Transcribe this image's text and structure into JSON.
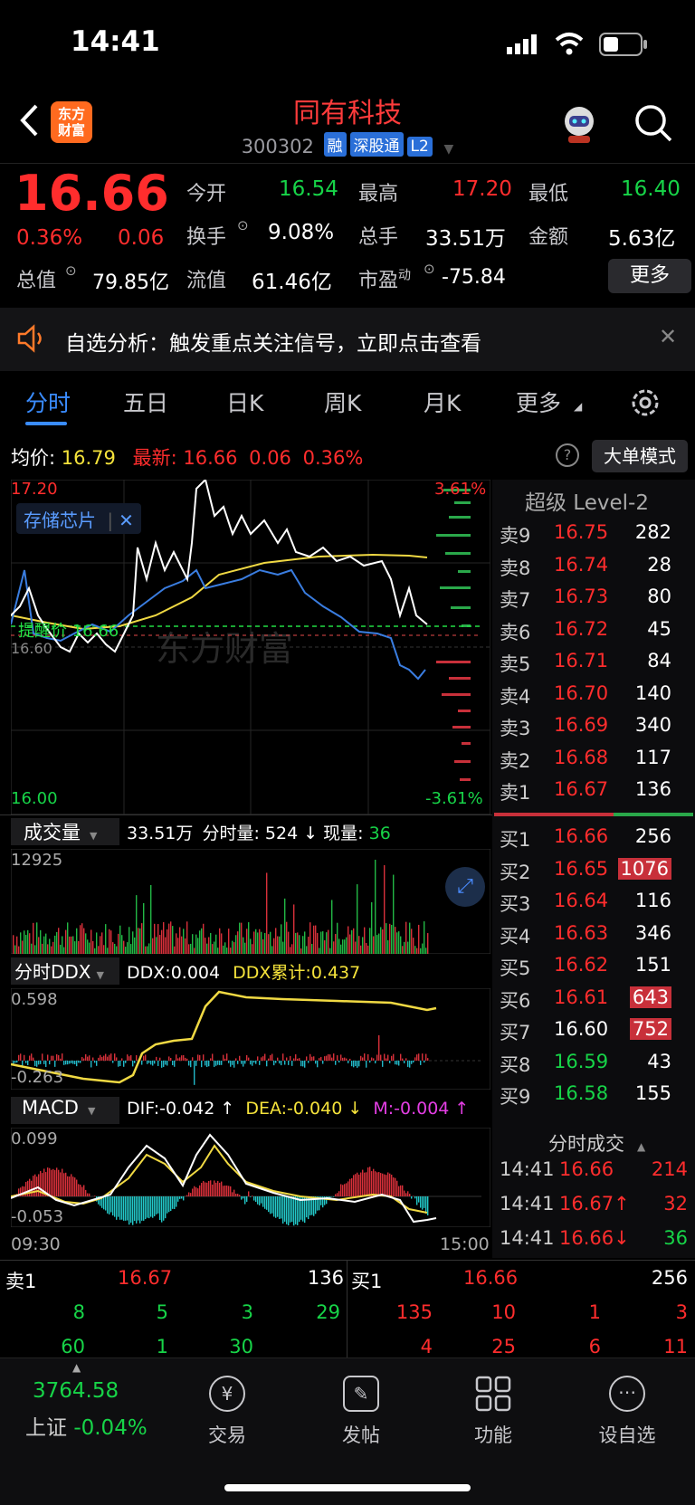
{
  "status_bar": {
    "time": "14:41"
  },
  "header": {
    "title": "同有科技",
    "code": "300302",
    "tags": [
      "融",
      "深股通",
      "L2"
    ],
    "logo_text": "东方财富"
  },
  "quote": {
    "price": "16.66",
    "change_pct": "0.36%",
    "change": "0.06",
    "open_label": "今开",
    "open": "16.54",
    "high_label": "最高",
    "high": "17.20",
    "low_label": "最低",
    "low": "16.40",
    "turnover_label": "换手",
    "turnover": "9.08%",
    "volume_label": "总手",
    "volume": "33.51万",
    "amount_label": "金额",
    "amount": "5.63亿",
    "mktcap_label": "总值",
    "mktcap": "79.85亿",
    "float_label": "流值",
    "float": "61.46亿",
    "pe_label": "市盈",
    "pe_sup": "动",
    "pe": "-75.84",
    "more_label": "更多"
  },
  "banner": {
    "text": "自选分析：触发重点关注信号，立即点击查看"
  },
  "tabs": [
    "分时",
    "五日",
    "日K",
    "周K",
    "月K",
    "更多"
  ],
  "chart_info": {
    "avg_label": "均价:",
    "avg": "16.79",
    "latest_label": "最新:",
    "latest": "16.66",
    "latest_chg": "0.06",
    "latest_pct": "0.36%",
    "mode_label": "大单模式",
    "ytop": "17.20",
    "ybottom": "16.00",
    "pct_top": "3.61%",
    "pct_bottom": "-3.61%",
    "sector_tag": "存储芯片",
    "alert_label": "提醒价 16.66",
    "left_mid": "16.60",
    "watermark": "东方财富"
  },
  "volume_panel": {
    "label": "成交量",
    "summary_total": "33.51万",
    "summary_label": "分时量:",
    "summary_val": "524",
    "now_label": "现量:",
    "now_val": "36",
    "ymax": "12925"
  },
  "ddx_panel": {
    "label": "分时DDX",
    "ddx_label": "DDX:",
    "ddx": "0.004",
    "cum_label": "DDX累计:",
    "cum": "0.437",
    "ytop": "0.598",
    "ybottom": "-0.263"
  },
  "macd_panel": {
    "label": "MACD",
    "dif": "DIF:-0.042 ↑",
    "dea": "DEA:-0.040 ↓",
    "m": "M:-0.004 ↑",
    "ytop": "0.099",
    "ybottom": "-0.053",
    "xstart": "09:30",
    "xend": "15:00"
  },
  "level2": {
    "title": "超级 Level-2",
    "asks": [
      {
        "label": "卖9",
        "price": "16.75",
        "vol": "282"
      },
      {
        "label": "卖8",
        "price": "16.74",
        "vol": "28"
      },
      {
        "label": "卖7",
        "price": "16.73",
        "vol": "80"
      },
      {
        "label": "卖6",
        "price": "16.72",
        "vol": "45"
      },
      {
        "label": "卖5",
        "price": "16.71",
        "vol": "84"
      },
      {
        "label": "卖4",
        "price": "16.70",
        "vol": "140"
      },
      {
        "label": "卖3",
        "price": "16.69",
        "vol": "340"
      },
      {
        "label": "卖2",
        "price": "16.68",
        "vol": "117"
      },
      {
        "label": "卖1",
        "price": "16.67",
        "vol": "136"
      }
    ],
    "bids": [
      {
        "label": "买1",
        "price": "16.66",
        "vol": "256"
      },
      {
        "label": "买2",
        "price": "16.65",
        "vol": "1076"
      },
      {
        "label": "买3",
        "price": "16.64",
        "vol": "116"
      },
      {
        "label": "买4",
        "price": "16.63",
        "vol": "346"
      },
      {
        "label": "买5",
        "price": "16.62",
        "vol": "151"
      },
      {
        "label": "买6",
        "price": "16.61",
        "vol": "643"
      },
      {
        "label": "买7",
        "price": "16.60",
        "vol": "752"
      },
      {
        "label": "买8",
        "price": "16.59",
        "vol": "43"
      },
      {
        "label": "买9",
        "price": "16.58",
        "vol": "155"
      }
    ],
    "trades_title": "分时成交",
    "trades": [
      {
        "time": "14:41",
        "price": "16.66",
        "vol": "214"
      },
      {
        "time": "14:41",
        "price": "16.67↑",
        "vol": "32"
      },
      {
        "time": "14:41",
        "price": "16.66↓",
        "vol": "36"
      }
    ]
  },
  "queue": {
    "ask_label": "卖1",
    "ask_price": "16.67",
    "ask_vol": "136",
    "bid_label": "买1",
    "bid_price": "16.66",
    "bid_vol": "256",
    "ask_row1": [
      "8",
      "5",
      "3",
      "29"
    ],
    "ask_row2": [
      "60",
      "1",
      "30"
    ],
    "bid_row1": [
      "135",
      "10",
      "1",
      "3"
    ],
    "bid_row2": [
      "4",
      "25",
      "6",
      "11"
    ]
  },
  "bottom_nav": {
    "index_value": "3764.58",
    "index_name": "上证",
    "index_change": "-0.04%",
    "items": [
      "交易",
      "发帖",
      "功能",
      "设自选"
    ]
  }
}
